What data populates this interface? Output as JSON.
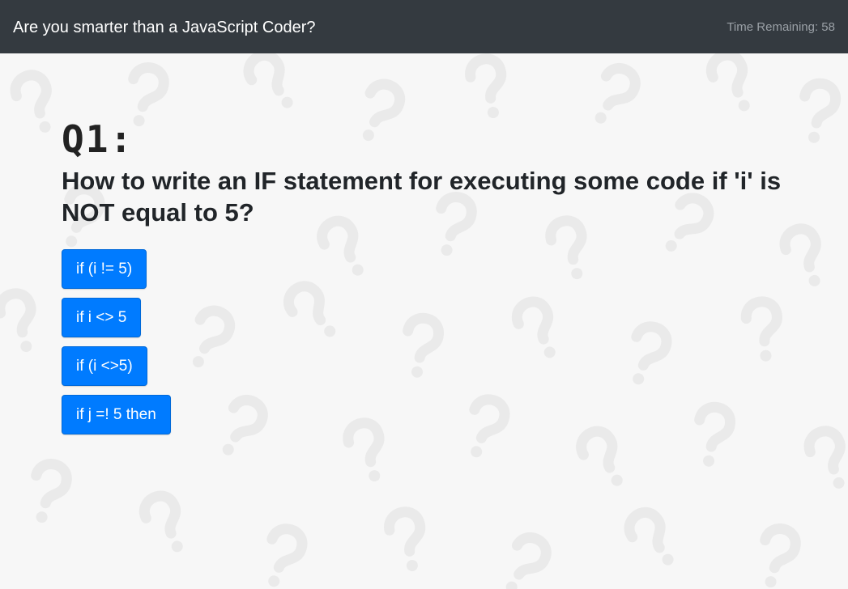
{
  "header": {
    "title": "Are you smarter than a JavaScript Coder?",
    "timer_label": "Time Remaining: 58"
  },
  "question": {
    "number_label": "Q1:",
    "text": "How to write an IF statement for executing some code if 'i' is NOT equal to 5?",
    "answers": [
      "if (i != 5)",
      "if i <> 5",
      "if (i <>5)",
      "if j =! 5 then"
    ]
  },
  "colors": {
    "navbar": "#343a40",
    "button": "#007bff",
    "background": "#f7f7f7",
    "pattern": "#ececec"
  },
  "background_icon": "question-mark-pattern"
}
